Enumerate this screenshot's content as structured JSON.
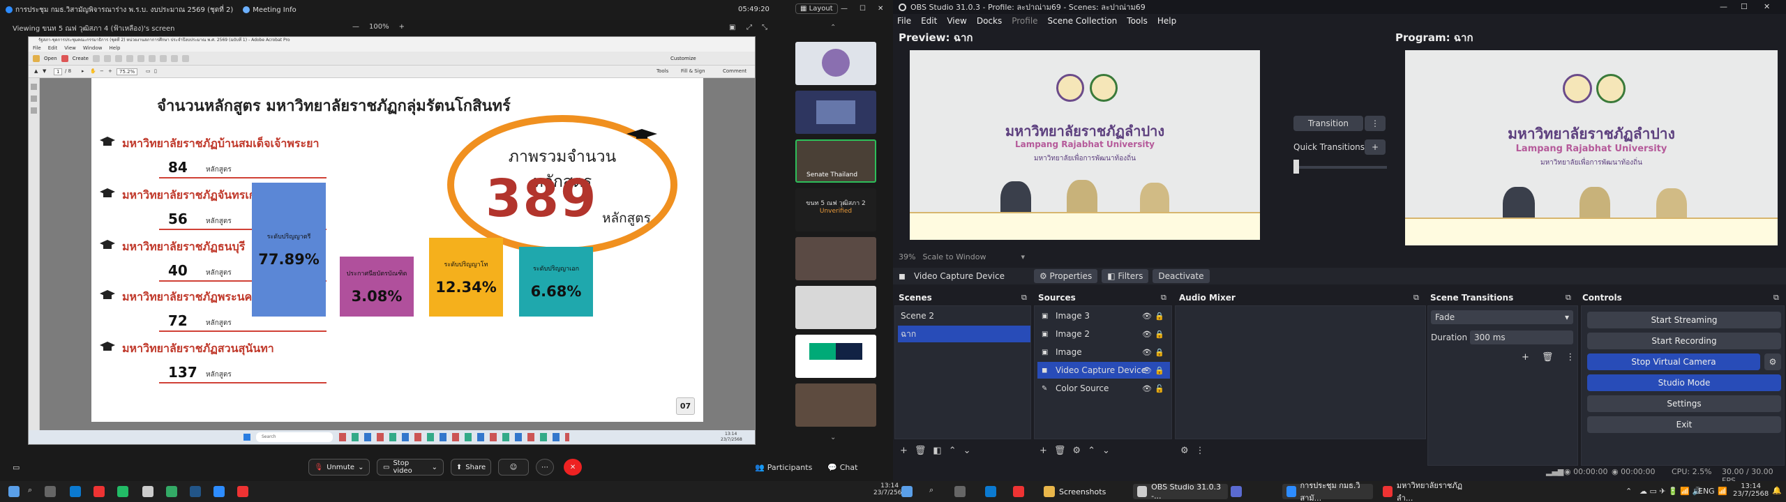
{
  "meeting": {
    "window_title": "การประชุม กมธ.วิสามัญพิจารณาร่าง พ.ร.บ. งบประมาณ 2569 (ชุดที่ 2)",
    "meeting_info_label": "Meeting Info",
    "view_label": "Viewing ขนท 5 ณฟ วุฒิสภา 4 (ฟ้าเหลือง)'s screen",
    "zoom_level": "100%",
    "time": "05:49:20",
    "layout_label": "Layout",
    "toolbar": {
      "unmute": "Unmute",
      "stop_video": "Stop video",
      "share": "Share",
      "participants": "Participants",
      "chat": "Chat"
    },
    "gallery": [
      {
        "label": ""
      },
      {
        "label": ""
      },
      {
        "label": "Senate Thailand"
      },
      {
        "label": "ขนท 5 ณฟ วุฒิสภา 2",
        "sub": "Unverified"
      },
      {
        "label": ""
      },
      {
        "label": ""
      },
      {
        "label": ""
      },
      {
        "label": ""
      }
    ]
  },
  "adobe": {
    "title": "รัฐสภา-ชุดการประชุมคณะกรรมาธิการ (ชุดที่ 2) หน่วยงานสภาการศึกษา ประจำปีงบประมาณ พ.ศ. 2569 (ฉบับที่ 1) - Adobe Acrobat Pro",
    "menu": [
      "File",
      "Edit",
      "View",
      "Window",
      "Help"
    ],
    "open": "Open",
    "create": "Create",
    "customize": "Customize",
    "page_input": "1",
    "page_total": "/ 8",
    "zoom": "75.2%",
    "tools": "Tools",
    "fill_sign": "Fill & Sign",
    "comment": "Comment",
    "search_placeholder": "Search",
    "clock": "13:14",
    "date": "23/7/2568"
  },
  "slide": {
    "title": "จำนวนหลักสูตร มหาวิทยาลัยราชภัฏกลุ่มรัตนโกสินทร์",
    "universities": [
      {
        "name": "มหาวิทยาลัยราชภัฏบ้านสมเด็จเจ้าพระยา",
        "count": "84",
        "unit": "หลักสูตร"
      },
      {
        "name": "มหาวิทยาลัยราชภัฏจันทรเกษม",
        "count": "56",
        "unit": "หลักสูตร"
      },
      {
        "name": "มหาวิทยาลัยราชภัฏธนบุรี",
        "count": "40",
        "unit": "หลักสูตร"
      },
      {
        "name": "มหาวิทยาลัยราชภัฏพระนคร",
        "count": "72",
        "unit": "หลักสูตร"
      },
      {
        "name": "มหาวิทยาลัยราชภัฏสวนสุนันทา",
        "count": "137",
        "unit": "หลักสูตร"
      }
    ],
    "summary_label": "ภาพรวมจำนวนหลักสูตร",
    "summary_total": "389",
    "summary_unit": "หลักสูตร",
    "page_number": "07",
    "bars": [
      {
        "label": "ระดับปริญญาตรี",
        "value": "77.89%",
        "fraction": 0.7789,
        "color": "#5b87d6"
      },
      {
        "label": "ประกาศนียบัตรบัณฑิต",
        "value": "3.08%",
        "fraction": 0.0308,
        "color": "#b0509c"
      },
      {
        "label": "ระดับปริญญาโท",
        "value": "12.34%",
        "fraction": 0.1234,
        "color": "#f5b01c"
      },
      {
        "label": "ระดับปริญญาเอก",
        "value": "6.68%",
        "fraction": 0.0668,
        "color": "#1fa8ad"
      }
    ]
  },
  "obs": {
    "title": "OBS Studio 31.0.3 - Profile: ละปาณ่าม69 - Scenes: ละปาณ่าม69",
    "menu": [
      "File",
      "Edit",
      "View",
      "Docks",
      "Profile",
      "Scene Collection",
      "Tools",
      "Help"
    ],
    "preview_label": "Preview: ฉาก",
    "program_label": "Program: ฉาก",
    "scale_zoom": "39%",
    "scale_label": "Scale to Window",
    "transition_button": "Transition",
    "quick_transitions": "Quick Transitions",
    "scene_image": {
      "thai": "มหาวิทยาลัยราชภัฏลำปาง",
      "english": "Lampang Rajabhat University",
      "sub": "มหาวิทยาลัยเพื่อการพัฒนาท้องถิ่น"
    },
    "source_toolbar": {
      "selected": "Video Capture Device",
      "properties": "Properties",
      "filters": "Filters",
      "deactivate": "Deactivate"
    },
    "docks": {
      "scenes": "Scenes",
      "sources": "Sources",
      "audio_mixer": "Audio Mixer",
      "scene_transitions": "Scene Transitions",
      "controls": "Controls"
    },
    "scenes": [
      "Scene 2",
      "ฉาก"
    ],
    "sources": [
      {
        "name": "Image 3",
        "icon": "image-icon"
      },
      {
        "name": "Image 2",
        "icon": "image-icon"
      },
      {
        "name": "Image",
        "icon": "image-icon"
      },
      {
        "name": "Video Capture Device",
        "icon": "camera-icon"
      },
      {
        "name": "Color Source",
        "icon": "brush-icon"
      }
    ],
    "transition": {
      "type": "Fade",
      "duration_label": "Duration",
      "duration_value": "300 ms"
    },
    "controls": [
      "Start Streaming",
      "Start Recording",
      "Stop Virtual Camera",
      "Studio Mode",
      "Settings",
      "Exit"
    ],
    "status": {
      "time1": "00:00:00",
      "time2": "00:00:00",
      "cpu": "CPU: 2.5%",
      "fps": "30.00 / 30.00 FPS"
    }
  },
  "taskbar": {
    "apps": [
      "Screenshots",
      "OBS Studio 31.0.3 -...",
      "การประชุม กมธ.วิสามั...",
      "มหาวิทยาลัยราชภัฏลำ..."
    ],
    "lang": "ENG",
    "time": "13:14",
    "date": "23/7/2568",
    "left_time": "13:14",
    "left_date": "23/7/2568"
  }
}
